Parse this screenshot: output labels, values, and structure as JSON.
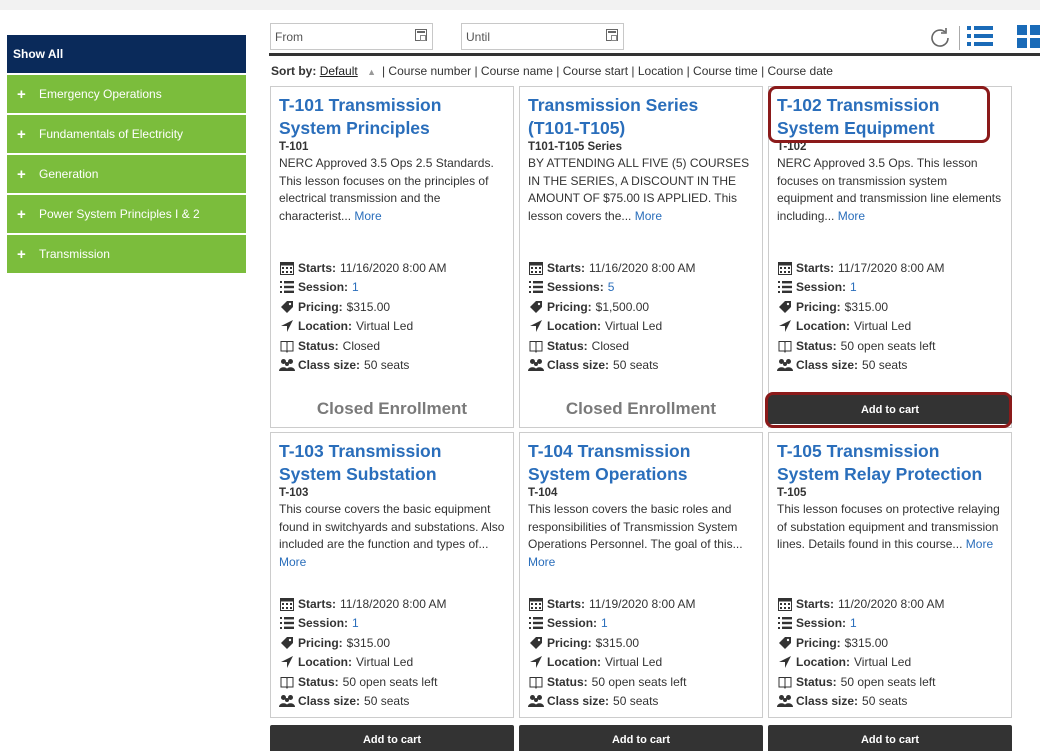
{
  "sidebar": {
    "show_all": "Show All",
    "items": [
      {
        "label": "Emergency Operations"
      },
      {
        "label": "Fundamentals of Electricity"
      },
      {
        "label": "Generation"
      },
      {
        "label": "Power System Principles I & 2"
      },
      {
        "label": "Transmission"
      }
    ]
  },
  "filters": {
    "from_placeholder": "From",
    "until_placeholder": "Until"
  },
  "sort": {
    "label": "Sort by:",
    "default": "Default",
    "options": "| Course number | Course name | Course start | Location | Course time | Course date"
  },
  "labels": {
    "starts": "Starts:",
    "session": "Session:",
    "sessions": "Sessions:",
    "pricing": "Pricing:",
    "location": "Location:",
    "status": "Status:",
    "class_size": "Class size:",
    "more": "More",
    "closed_enrollment": "Closed Enrollment",
    "add_to_cart": "Add to cart"
  },
  "colors": {
    "sidebar_header": "#0a2a5a",
    "sidebar_item": "#7bbd3c",
    "title_link": "#2a6ebb",
    "highlight": "#8b1a1a",
    "button": "#333333"
  },
  "courses": [
    {
      "title": "T-101 Transmission System Principles",
      "code": "T-101",
      "desc": "NERC Approved 3.5 Ops 2.5 Standards. This lesson focuses on the principles of electrical transmission and the characterist...",
      "starts": "11/16/2020 8:00 AM",
      "session_count": "1",
      "pricing": "$315.00",
      "location": "Virtual Led",
      "status": "Closed",
      "class_size": "50 seats",
      "action": "closed"
    },
    {
      "title": "Transmission Series (T101-T105)",
      "code": "T101-T105 Series",
      "desc": "BY ATTENDING ALL FIVE (5) COURSES IN THE SERIES, A DISCOUNT IN THE AMOUNT OF $75.00 IS APPLIED. This lesson covers the...",
      "starts": "11/16/2020 8:00 AM",
      "session_count": "5",
      "pricing": "$1,500.00",
      "location": "Virtual Led",
      "status": "Closed",
      "class_size": "50 seats",
      "action": "closed"
    },
    {
      "title": "T-102 Transmission System Equipment",
      "code": "T-102",
      "desc": "NERC Approved 3.5 Ops.  This lesson focuses on transmission system equipment and transmission line elements including...",
      "starts": "11/17/2020 8:00 AM",
      "session_count": "1",
      "pricing": "$315.00",
      "location": "Virtual Led",
      "status": "50 open seats left",
      "class_size": "50 seats",
      "action": "cart"
    },
    {
      "title": "T-103 Transmission System Substation",
      "code": "T-103",
      "desc": "This course covers the basic equipment found in switchyards and substations. Also included are the function and types of...",
      "starts": "11/18/2020 8:00 AM",
      "session_count": "1",
      "pricing": "$315.00",
      "location": "Virtual Led",
      "status": "50 open seats left",
      "class_size": "50 seats",
      "action": "cart"
    },
    {
      "title": "T-104 Transmission System Operations",
      "code": "T-104",
      "desc": "This lesson covers the basic roles and responsibilities of Transmission System Operations Personnel. The goal of this...",
      "starts": "11/19/2020 8:00 AM",
      "session_count": "1",
      "pricing": "$315.00",
      "location": "Virtual Led",
      "status": "50 open seats left",
      "class_size": "50 seats",
      "action": "cart"
    },
    {
      "title": "T-105 Transmission System Relay Protection",
      "code": "T-105",
      "desc": "This lesson focuses on protective relaying of substation equipment and transmission lines. Details found in this course...",
      "starts": "11/20/2020 8:00 AM",
      "session_count": "1",
      "pricing": "$315.00",
      "location": "Virtual Led",
      "status": "50 open seats left",
      "class_size": "50 seats",
      "action": "cart"
    }
  ]
}
